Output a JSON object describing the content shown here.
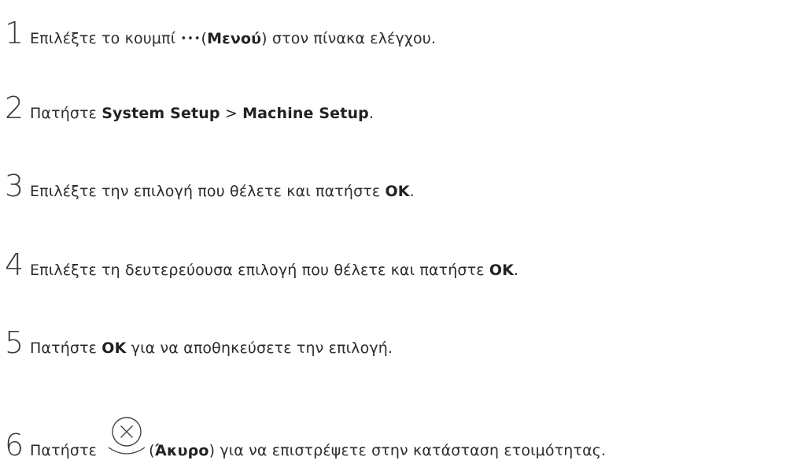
{
  "steps": [
    {
      "number": "1",
      "prefix": "Επιλέξτε το κουμπί ",
      "icon": "menu-dots-icon",
      "icon_text": "•••",
      "open_paren": "(",
      "bold": "Μενού",
      "suffix": ") στον πίνακα ελέγχου."
    },
    {
      "number": "2",
      "prefix": "Πατήστε ",
      "bold1": "System Setup",
      "separator": " > ",
      "bold2": "Machine Setup",
      "suffix": "."
    },
    {
      "number": "3",
      "prefix": "Επιλέξτε την επιλογή που θέλετε και πατήστε ",
      "bold": "OK",
      "suffix": "."
    },
    {
      "number": "4",
      "prefix": "Επιλέξτε τη δευτερεύουσα επιλογή που θέλετε και πατήστε ",
      "bold": "OK",
      "suffix": "."
    },
    {
      "number": "5",
      "prefix": "Πατήστε ",
      "bold": "OK",
      "suffix": " για να αποθηκεύσετε την επιλογή."
    },
    {
      "number": "6",
      "prefix": "Πατήστε",
      "icon": "cancel-icon",
      "open_paren": "(",
      "bold": "Άκυρο",
      "suffix": ") για να επιστρέψετε στην κατάσταση ετοιμότητας."
    }
  ]
}
